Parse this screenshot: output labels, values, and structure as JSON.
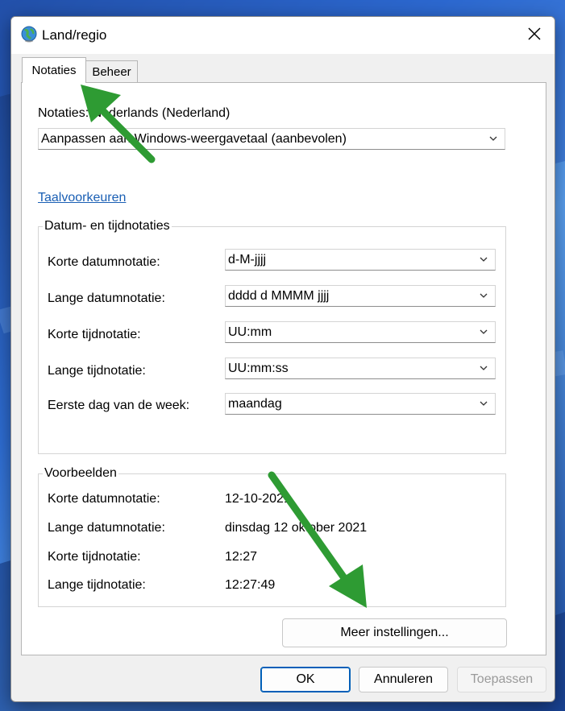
{
  "window": {
    "title": "Land/regio",
    "close_icon": "close-icon"
  },
  "tabs": [
    {
      "label": "Notaties",
      "active": true
    },
    {
      "label": "Beheer",
      "active": false
    }
  ],
  "format": {
    "label": "Notaties: Nederlands (Nederland)",
    "value": "Aanpassen aan Windows-weergavetaal (aanbevolen)"
  },
  "language_link": "Taalvoorkeuren",
  "date_time": {
    "legend": "Datum- en tijdnotaties",
    "rows": [
      {
        "label": "Korte datumnotatie:",
        "value": "d-M-jjjj"
      },
      {
        "label": "Lange datumnotatie:",
        "value": "dddd d MMMM jjjj"
      },
      {
        "label": "Korte tijdnotatie:",
        "value": "UU:mm"
      },
      {
        "label": "Lange tijdnotatie:",
        "value": "UU:mm:ss"
      },
      {
        "label": "Eerste dag van de week:",
        "value": "maandag"
      }
    ]
  },
  "examples": {
    "legend": "Voorbeelden",
    "rows": [
      {
        "label": "Korte datumnotatie:",
        "value": "12-10-2021"
      },
      {
        "label": "Lange datumnotatie:",
        "value": "dinsdag 12 oktober 2021"
      },
      {
        "label": "Korte tijdnotatie:",
        "value": "12:27"
      },
      {
        "label": "Lange tijdnotatie:",
        "value": "12:27:49"
      }
    ]
  },
  "more_settings": "Meer instellingen...",
  "buttons": {
    "ok": "OK",
    "cancel": "Annuleren",
    "apply": "Toepassen"
  },
  "colors": {
    "arrow": "#2e9b33",
    "link": "#1a5fb4",
    "accent": "#005fb8"
  }
}
